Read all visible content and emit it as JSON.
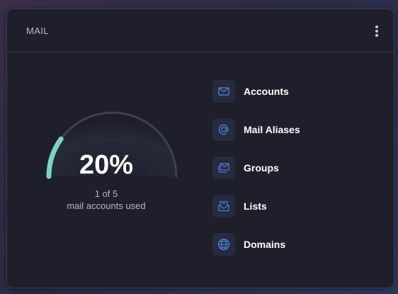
{
  "widget": {
    "title": "MAIL",
    "menu_icon": "more-vertical-icon"
  },
  "usage": {
    "percent_label": "20%",
    "fraction": 0.2,
    "count_label": "1 of 5",
    "description": "mail accounts used"
  },
  "menu": {
    "items": [
      {
        "label": "Accounts",
        "icon": "envelope-icon"
      },
      {
        "label": "Mail Aliases",
        "icon": "at-sign-icon"
      },
      {
        "label": "Groups",
        "icon": "envelopes-icon"
      },
      {
        "label": "Lists",
        "icon": "mail-list-icon"
      },
      {
        "label": "Domains",
        "icon": "globe-icon"
      }
    ]
  },
  "colors": {
    "accent": "#7ed3c2",
    "icon": "#4d7bd6"
  }
}
